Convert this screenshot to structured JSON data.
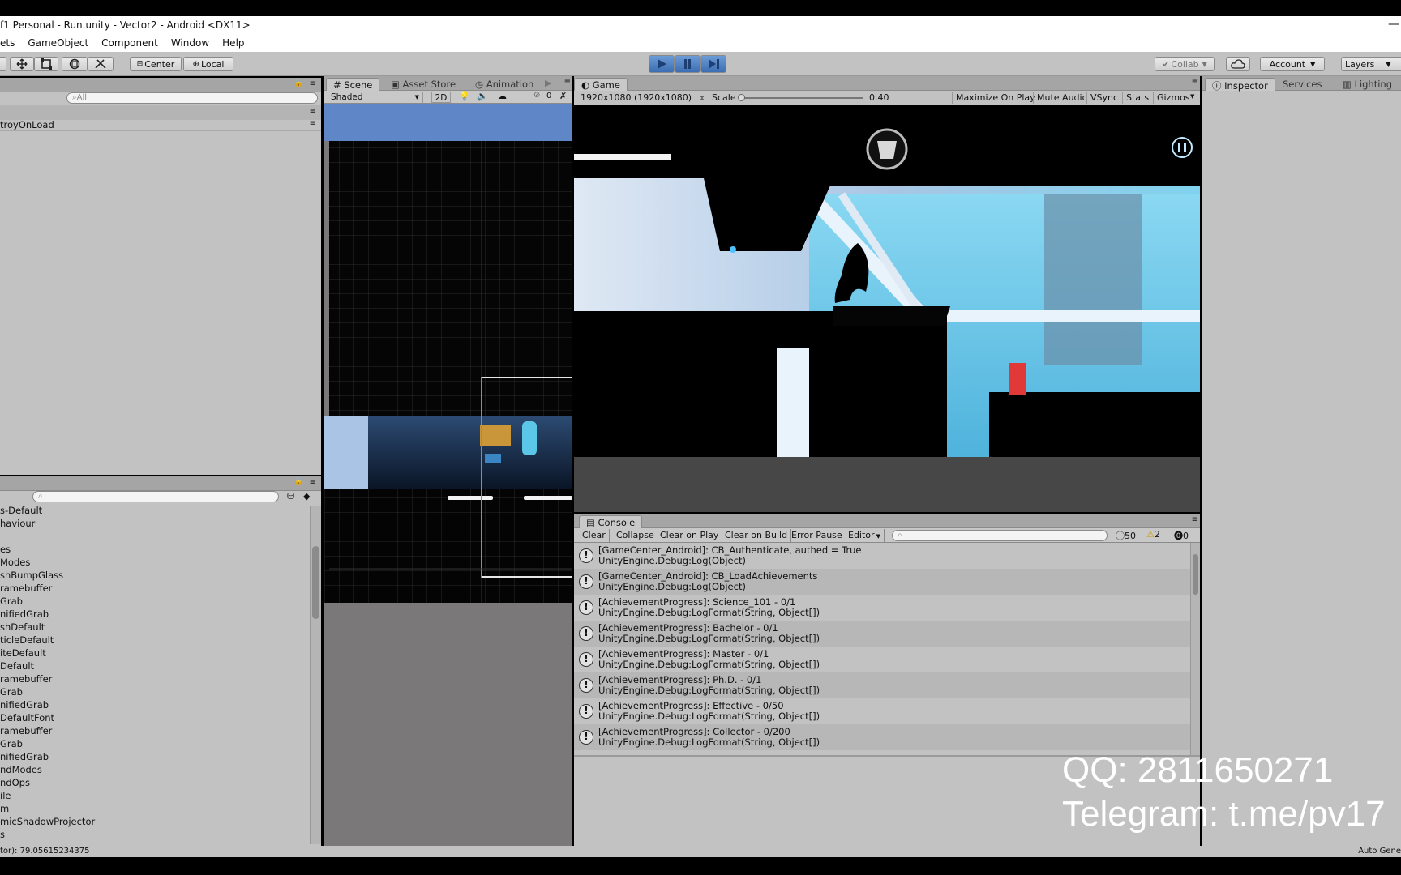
{
  "window": {
    "title": "f1 Personal - Run.unity - Vector2 - Android <DX11>",
    "close_glyph": "—"
  },
  "menu": [
    "ets",
    "GameObject",
    "Component",
    "Window",
    "Help"
  ],
  "toolbar": {
    "center_label": "Center",
    "local_label": "Local",
    "collab_label": "Collab",
    "account_label": "Account",
    "layers_label": "Layers"
  },
  "hierarchy": {
    "search_placeholder": "All",
    "row_label": "troyOnLoad"
  },
  "project": {
    "items": [
      "s-Default",
      "haviour",
      "",
      "es",
      "Modes",
      "shBumpGlass",
      "ramebuffer",
      "Grab",
      "nifiedGrab",
      "shDefault",
      "ticleDefault",
      "iteDefault",
      "Default",
      "ramebuffer",
      "Grab",
      "nifiedGrab",
      "DefaultFont",
      "ramebuffer",
      "Grab",
      "nifiedGrab",
      "ndModes",
      "ndOps",
      "ile",
      "m",
      "micShadowProjector",
      "s"
    ]
  },
  "scene": {
    "tabs": [
      "Scene",
      "Asset Store",
      "Animation"
    ],
    "shading_mode": "Shaded",
    "mode_2d": "2D",
    "gizmo_count": "0"
  },
  "game": {
    "tab_label": "Game",
    "resolution": "1920x1080 (1920x1080)",
    "scale_label": "Scale",
    "scale_value": "0.40",
    "toggles": [
      "Maximize On Play",
      "Mute Audio",
      "VSync",
      "Stats",
      "Gizmos"
    ]
  },
  "inspector": {
    "tabs": [
      "Inspector",
      "Services",
      "Lighting"
    ]
  },
  "console": {
    "tab_label": "Console",
    "buttons": [
      "Clear",
      "Collapse",
      "Clear on Play",
      "Clear on Build",
      "Error Pause",
      "Editor"
    ],
    "log_count": "50",
    "warn_count": "2",
    "error_count": "0",
    "entries": [
      {
        "line1": "[GameCenter_Android]: CB_Authenticate, authed = True",
        "line2": "UnityEngine.Debug:Log(Object)"
      },
      {
        "line1": "[GameCenter_Android]: CB_LoadAchievements",
        "line2": "UnityEngine.Debug:Log(Object)"
      },
      {
        "line1": "[AchievementProgress]: Science_101 - 0/1",
        "line2": "UnityEngine.Debug:LogFormat(String, Object[])"
      },
      {
        "line1": "[AchievementProgress]: Bachelor - 0/1",
        "line2": "UnityEngine.Debug:LogFormat(String, Object[])"
      },
      {
        "line1": "[AchievementProgress]: Master - 0/1",
        "line2": "UnityEngine.Debug:LogFormat(String, Object[])"
      },
      {
        "line1": "[AchievementProgress]: Ph.D. - 0/1",
        "line2": "UnityEngine.Debug:LogFormat(String, Object[])"
      },
      {
        "line1": "[AchievementProgress]: Effective - 0/50",
        "line2": "UnityEngine.Debug:LogFormat(String, Object[])"
      },
      {
        "line1": "[AchievementProgress]: Collector - 0/200",
        "line2": "UnityEngine.Debug:LogFormat(String, Object[])"
      }
    ]
  },
  "watermark": {
    "qq": "QQ: 2811650271",
    "telegram": "Telegram: t.me/pv17"
  },
  "statusbar": {
    "left_text": "tor): 79.05615234375",
    "right_text": "Auto Gene"
  },
  "colors": {
    "editor_gray": "#c2c2c2",
    "play_blue": "#3c6fb2",
    "game_cyan": "#7fd2ee"
  }
}
